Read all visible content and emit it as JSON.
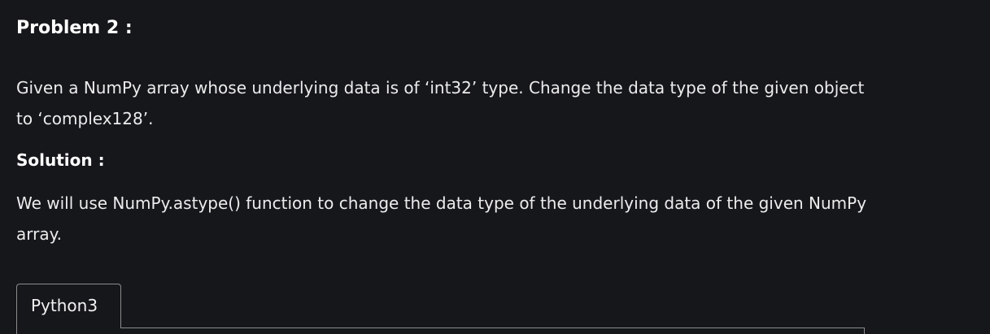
{
  "article": {
    "problem_heading": "Problem 2 :",
    "problem_text": "Given a NumPy array whose underlying data is of ‘int32’ type. Change the data type of the given object to ‘complex128’.",
    "solution_heading": "Solution :",
    "solution_text": "We will use NumPy.astype() function to change the data type of the underlying data of the given NumPy array."
  },
  "code_block": {
    "tabs": [
      {
        "label": "Python3",
        "selected": true
      }
    ]
  },
  "colors": {
    "background": "#16171b",
    "text": "#ececec",
    "border": "#8c8c8c"
  }
}
